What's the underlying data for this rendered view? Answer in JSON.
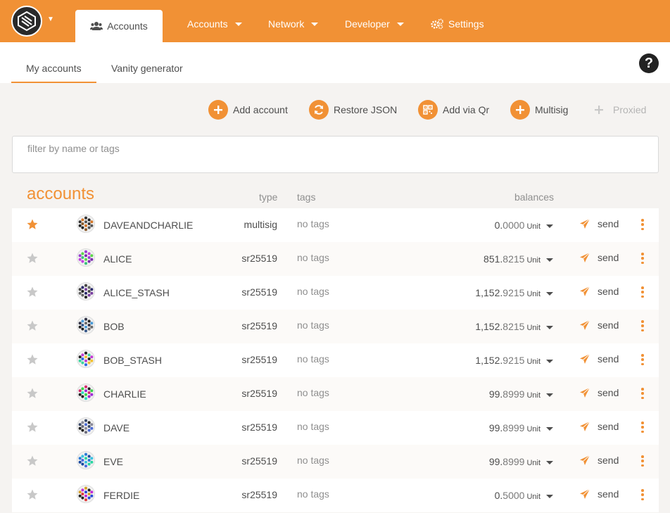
{
  "colors": {
    "accent": "#f19135",
    "star_active": "#f19135",
    "star_inactive": "#c8c8c8"
  },
  "topnav": {
    "active_tab": {
      "label": "Accounts",
      "icon": "users-icon"
    },
    "items": [
      {
        "label": "Accounts"
      },
      {
        "label": "Network"
      },
      {
        "label": "Developer"
      },
      {
        "label": "Settings",
        "icon": "gears-icon"
      }
    ]
  },
  "subnav": {
    "tabs": [
      {
        "label": "My accounts",
        "active": true
      },
      {
        "label": "Vanity generator"
      }
    ],
    "help_icon": "question-circle-icon"
  },
  "actions": [
    {
      "label": "Add account",
      "icon": "plus-icon"
    },
    {
      "label": "Restore JSON",
      "icon": "sync-icon"
    },
    {
      "label": "Add via Qr",
      "icon": "qrcode-icon"
    },
    {
      "label": "Multisig",
      "icon": "plus-icon"
    },
    {
      "label": "Proxied",
      "icon": "plus-icon",
      "disabled": true
    }
  ],
  "filter": {
    "placeholder": "filter by name or tags"
  },
  "table": {
    "title": "accounts",
    "headers": {
      "type": "type",
      "tags": "tags",
      "balances": "balances"
    },
    "send_label": "send",
    "rows": [
      {
        "name": "DAVEANDCHARLIE",
        "type": "multisig",
        "tags": "no tags",
        "bal_int": "0.",
        "bal_dec": "0000",
        "unit": "Unit",
        "starred": true
      },
      {
        "name": "ALICE",
        "type": "sr25519",
        "tags": "no tags",
        "bal_int": "851.",
        "bal_dec": "8215",
        "unit": "Unit",
        "starred": false
      },
      {
        "name": "ALICE_STASH",
        "type": "sr25519",
        "tags": "no tags",
        "bal_int": "1,152.",
        "bal_dec": "9215",
        "unit": "Unit",
        "starred": false
      },
      {
        "name": "BOB",
        "type": "sr25519",
        "tags": "no tags",
        "bal_int": "1,152.",
        "bal_dec": "8215",
        "unit": "Unit",
        "starred": false
      },
      {
        "name": "BOB_STASH",
        "type": "sr25519",
        "tags": "no tags",
        "bal_int": "1,152.",
        "bal_dec": "9215",
        "unit": "Unit",
        "starred": false
      },
      {
        "name": "CHARLIE",
        "type": "sr25519",
        "tags": "no tags",
        "bal_int": "99.",
        "bal_dec": "8999",
        "unit": "Unit",
        "starred": false
      },
      {
        "name": "DAVE",
        "type": "sr25519",
        "tags": "no tags",
        "bal_int": "99.",
        "bal_dec": "8999",
        "unit": "Unit",
        "starred": false
      },
      {
        "name": "EVE",
        "type": "sr25519",
        "tags": "no tags",
        "bal_int": "99.",
        "bal_dec": "8999",
        "unit": "Unit",
        "starred": false
      },
      {
        "name": "FERDIE",
        "type": "sr25519",
        "tags": "no tags",
        "bal_int": "0.",
        "bal_dec": "5000",
        "unit": "Unit",
        "starred": false
      }
    ]
  }
}
